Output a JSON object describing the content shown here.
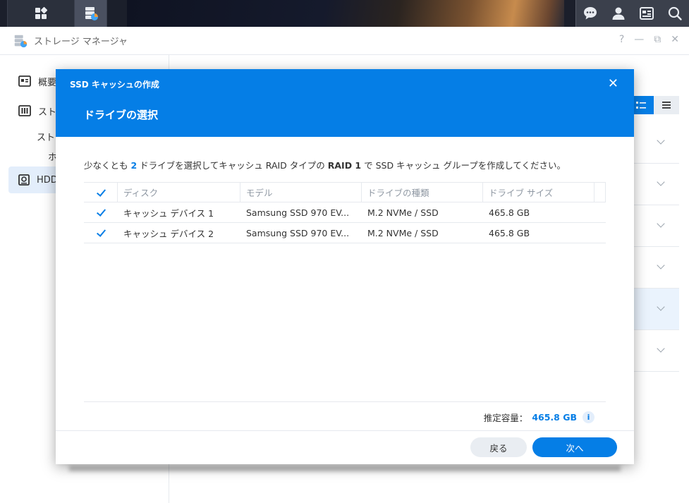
{
  "app": {
    "title": "ストレージ マネージャ"
  },
  "sidebar": {
    "items": [
      {
        "label": "概要"
      },
      {
        "label": "スト"
      },
      {
        "label": "スト"
      },
      {
        "label": "ホ"
      },
      {
        "label": "HDD"
      }
    ]
  },
  "dialog": {
    "title": "SSD キャッシュの作成",
    "heading": "ドライブの選択",
    "instruction": {
      "part1": "少なくとも ",
      "count": "2",
      "part2": " ドライブを選択してキャッシュ RAID タイプの ",
      "raid": "RAID 1",
      "part3": " で SSD キャッシュ グループを作成してください。"
    },
    "table": {
      "columns": [
        "ディスク",
        "モデル",
        "ドライブの種類",
        "ドライブ サイズ"
      ],
      "rows": [
        {
          "disk": "キャッシュ デバイス 1",
          "model": "Samsung SSD 970 EV...",
          "type": "M.2 NVMe / SSD",
          "size": "465.8 GB"
        },
        {
          "disk": "キャッシュ デバイス 2",
          "model": "Samsung SSD 970 EV...",
          "type": "M.2 NVMe / SSD",
          "size": "465.8 GB"
        }
      ]
    },
    "capacity_label": "推定容量：",
    "capacity_value": "465.8 GB",
    "info_glyph": "i",
    "back_label": "戻る",
    "next_label": "次へ",
    "close_glyph": "✕"
  },
  "window_controls": {
    "help": "?",
    "minimize": "—",
    "restore": "⧉",
    "close": "✕"
  },
  "colors": {
    "accent": "#057ee6",
    "taskbar": "#1b1f2b"
  }
}
